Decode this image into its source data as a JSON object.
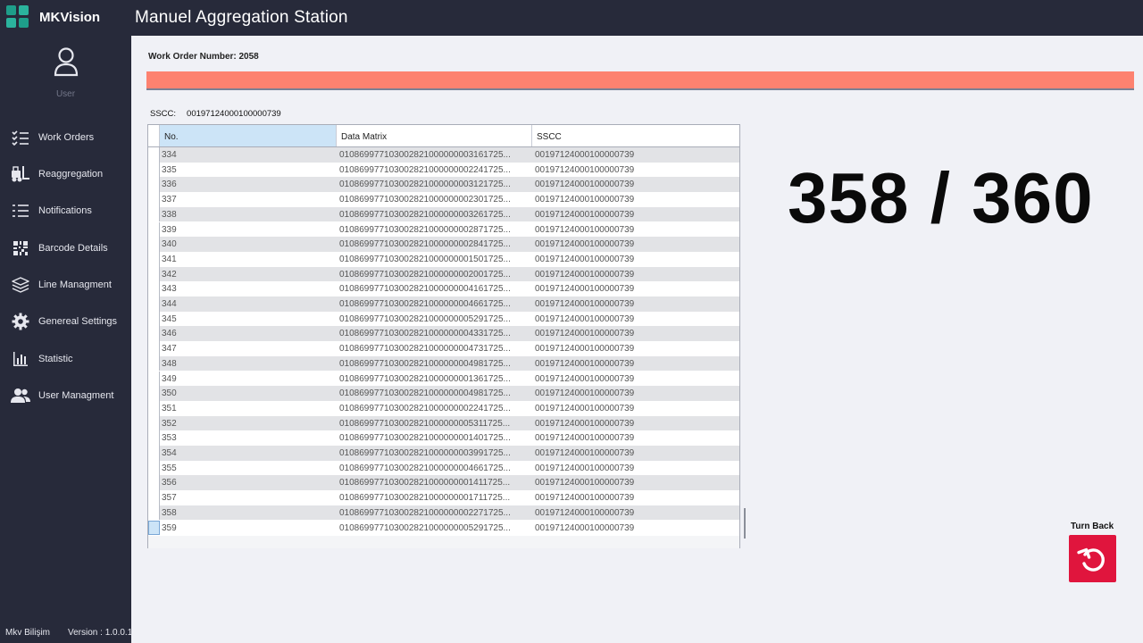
{
  "app": {
    "brand": "MKVision",
    "title": "Manuel Aggregation Station",
    "accent_color": "#1e9e8a"
  },
  "sidebar": {
    "user_label": "User",
    "items": [
      {
        "label": "Work Orders",
        "icon": "list-check-icon"
      },
      {
        "label": "Reaggregation",
        "icon": "forklift-icon"
      },
      {
        "label": "Notifications",
        "icon": "list-bullet-icon"
      },
      {
        "label": "Barcode Details",
        "icon": "barcode-icon"
      },
      {
        "label": "Line Managment",
        "icon": "layers-icon"
      },
      {
        "label": "Genereal Settings",
        "icon": "gear-icon"
      },
      {
        "label": "Statistic",
        "icon": "bar-chart-icon"
      },
      {
        "label": "User Managment",
        "icon": "users-icon"
      }
    ],
    "company": "Mkv Bilişim",
    "version": "Version : 1.0.0.1"
  },
  "main": {
    "work_order": "Work Order Number: 2058",
    "alert_color": "#fd8270",
    "sscc_label": "SSCC:",
    "sscc_value": "00197124000100000739"
  },
  "table": {
    "columns": [
      "No.",
      "Data Matrix",
      "SSCC"
    ],
    "rows": [
      [
        "334",
        "010869977103002821000000003161725...",
        "00197124000100000739"
      ],
      [
        "335",
        "010869977103002821000000002241725...",
        "00197124000100000739"
      ],
      [
        "336",
        "010869977103002821000000003121725...",
        "00197124000100000739"
      ],
      [
        "337",
        "010869977103002821000000002301725...",
        "00197124000100000739"
      ],
      [
        "338",
        "010869977103002821000000003261725...",
        "00197124000100000739"
      ],
      [
        "339",
        "010869977103002821000000002871725...",
        "00197124000100000739"
      ],
      [
        "340",
        "010869977103002821000000002841725...",
        "00197124000100000739"
      ],
      [
        "341",
        "010869977103002821000000001501725...",
        "00197124000100000739"
      ],
      [
        "342",
        "010869977103002821000000002001725...",
        "00197124000100000739"
      ],
      [
        "343",
        "010869977103002821000000004161725...",
        "00197124000100000739"
      ],
      [
        "344",
        "010869977103002821000000004661725...",
        "00197124000100000739"
      ],
      [
        "345",
        "010869977103002821000000005291725...",
        "00197124000100000739"
      ],
      [
        "346",
        "010869977103002821000000004331725...",
        "00197124000100000739"
      ],
      [
        "347",
        "010869977103002821000000004731725...",
        "00197124000100000739"
      ],
      [
        "348",
        "010869977103002821000000004981725...",
        "00197124000100000739"
      ],
      [
        "349",
        "010869977103002821000000001361725...",
        "00197124000100000739"
      ],
      [
        "350",
        "010869977103002821000000004981725...",
        "00197124000100000739"
      ],
      [
        "351",
        "010869977103002821000000002241725...",
        "00197124000100000739"
      ],
      [
        "352",
        "010869977103002821000000005311725...",
        "00197124000100000739"
      ],
      [
        "353",
        "010869977103002821000000001401725...",
        "00197124000100000739"
      ],
      [
        "354",
        "010869977103002821000000003991725...",
        "00197124000100000739"
      ],
      [
        "355",
        "010869977103002821000000004661725...",
        "00197124000100000739"
      ],
      [
        "356",
        "010869977103002821000000001411725...",
        "00197124000100000739"
      ],
      [
        "357",
        "010869977103002821000000001711725...",
        "00197124000100000739"
      ],
      [
        "358",
        "010869977103002821000000002271725...",
        "00197124000100000739"
      ],
      [
        "359",
        "010869977103002821000000005291725...",
        "00197124000100000739"
      ]
    ]
  },
  "counter": {
    "text": "358 / 360"
  },
  "turn_back": {
    "label": "Turn Back",
    "icon": "undo-icon",
    "color": "#e0153d"
  }
}
